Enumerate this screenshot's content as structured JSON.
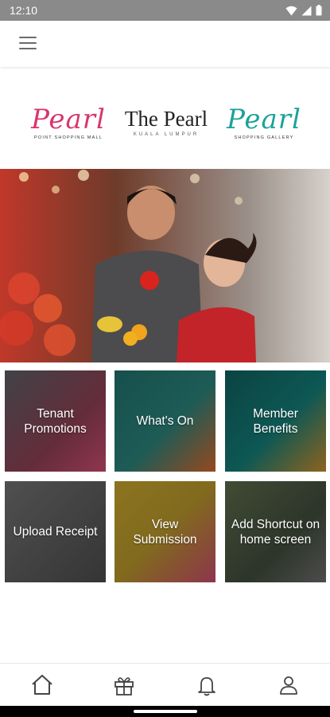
{
  "status_bar": {
    "time": "12:10"
  },
  "logos": {
    "left": {
      "name": "Pearl",
      "tagline": "POINT SHOPPING MALL",
      "color": "#d9366b"
    },
    "center": {
      "name": "The Pearl",
      "tagline": "KUALA LUMPUR",
      "color": "#222222"
    },
    "right": {
      "name": "Pearl",
      "tagline": "SHOPPING GALLERY",
      "color": "#1aa39a"
    }
  },
  "tiles": [
    {
      "label": "Tenant Promotions",
      "color": "#7a3b4a"
    },
    {
      "label": "What's On",
      "color": "#1f6f6a"
    },
    {
      "label": "Member Benefits",
      "color": "#0f5e5c"
    },
    {
      "label": "Upload Receipt",
      "color": "#4a4a4a"
    },
    {
      "label": "View Submission",
      "color": "#b89a2a"
    },
    {
      "label": "Add Shortcut on home screen",
      "color": "#4e5a44"
    }
  ],
  "bottom_nav": [
    "home-icon",
    "gift-icon",
    "bell-icon",
    "user-icon"
  ]
}
